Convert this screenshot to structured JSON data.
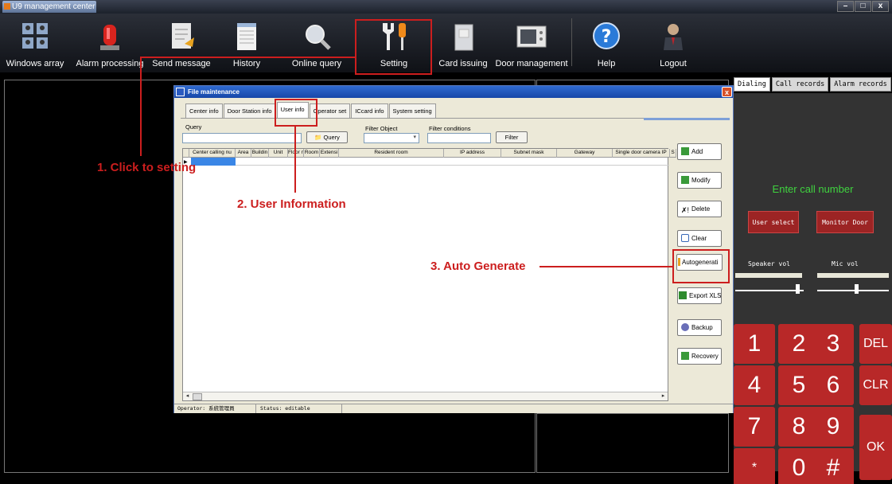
{
  "window": {
    "title": "U9 management center",
    "controls": [
      "–",
      "□",
      "x"
    ]
  },
  "toolbar": {
    "items": [
      {
        "label": "Windows array",
        "icon": "windows-array-icon"
      },
      {
        "label": "Alarm processing",
        "icon": "alarm-light-icon"
      },
      {
        "label": "Send message",
        "icon": "send-message-icon"
      },
      {
        "label": "History",
        "icon": "history-icon"
      },
      {
        "label": "Online query",
        "icon": "magnifier-icon"
      },
      {
        "label": "Setting",
        "icon": "wrench-screwdriver-icon"
      },
      {
        "label": "Card issuing",
        "icon": "card-issuing-icon"
      },
      {
        "label": "Door management",
        "icon": "door-management-icon"
      },
      {
        "label": "Help",
        "icon": "help-icon"
      },
      {
        "label": "Logout",
        "icon": "logout-user-icon"
      }
    ]
  },
  "right_panel": {
    "tabs": [
      "Dialing",
      "Call records",
      "Alarm records"
    ],
    "active_tab": "Dialing",
    "call_number_prompt": "Enter call number",
    "user_select": "User select",
    "monitor_door": "Monitor Door",
    "speaker_vol": "Speaker vol",
    "mic_vol": "Mic vol",
    "keys": [
      "1",
      "2",
      "3",
      "DEL",
      "4",
      "5",
      "6",
      "CLR",
      "7",
      "8",
      "9",
      "OK",
      "*",
      "0",
      "#"
    ]
  },
  "dialog": {
    "title": "File maintenance",
    "close": "x",
    "tabs": [
      "Center info",
      "Door Station info",
      "User info",
      "Operator set",
      "ICcard info",
      "System setting"
    ],
    "active_tab": "User info",
    "query_label": "Query",
    "query_button": "Query",
    "filter_object_label": "Filter Object",
    "filter_conditions_label": "Filter conditions",
    "filter_button": "Filter",
    "columns": [
      "Center calling nu",
      "Area",
      "Buildin",
      "Unit",
      "Floor n",
      "Room",
      "Extensi",
      "Resident room",
      "IP address",
      "Subnet mask",
      "Gateway",
      "Single door camera IP",
      "S"
    ],
    "side_buttons": [
      "Add",
      "Modify",
      "Delete",
      "Clear",
      "Autogenerati",
      "Export XLS",
      "Backup",
      "Recovery"
    ],
    "status_operator": "Operator: 系統管理員",
    "status_state": "Status: editable"
  },
  "annotations": {
    "step1": "1. Click to setting",
    "step2": "2. User Information",
    "step3": "3. Auto Generate"
  },
  "colors": {
    "annotation_red": "#cc1e1e",
    "dial_key_red": "#b82828",
    "call_prompt_green": "#3fd33f",
    "dialog_title_blue": "#1747a8"
  }
}
